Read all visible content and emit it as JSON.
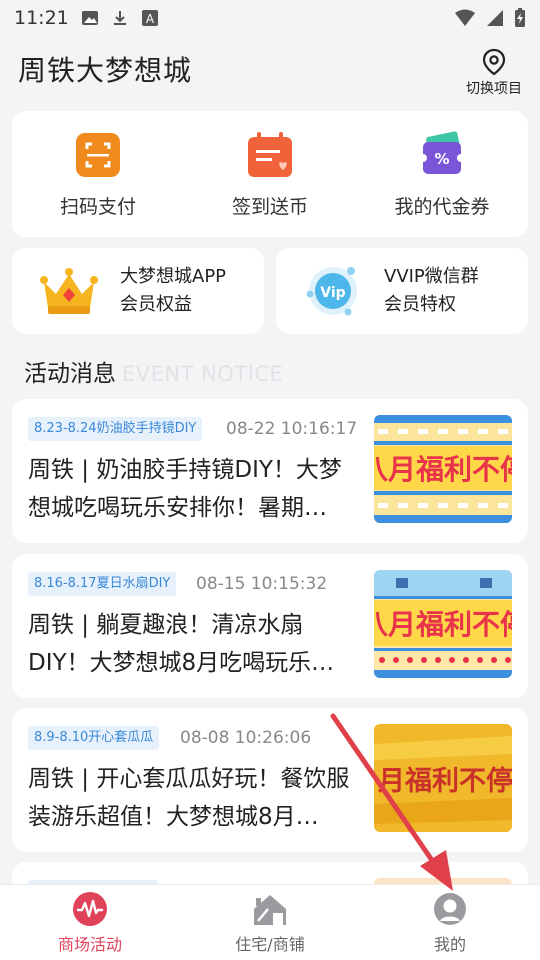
{
  "status_bar": {
    "time": "11:21"
  },
  "header": {
    "title": "周铁大梦想城",
    "switch_label": "切换项目"
  },
  "quick_actions": [
    {
      "label": "扫码支付",
      "icon": "scan-icon"
    },
    {
      "label": "签到送币",
      "icon": "calendar-icon"
    },
    {
      "label": "我的代金券",
      "icon": "voucher-icon"
    }
  ],
  "members": [
    {
      "line1": "大梦想城APP",
      "line2": "会员权益",
      "icon": "crown-icon"
    },
    {
      "line1": "VVIP微信群",
      "line2": "会员特权",
      "icon": "vip-icon"
    }
  ],
  "section": {
    "title": "活动消息",
    "subtitle": "EVENT NOTICE"
  },
  "events": [
    {
      "tag": "8.23-8.24奶油胶手持镜DIY",
      "date": "08-22 10:16:17",
      "text": "周铁 | 奶油胶手持镜DIY！大梦想城吃喝玩乐安排你！暑期…",
      "banner_text": "八月福利不停"
    },
    {
      "tag": "8.16-8.17夏日水扇DIY",
      "date": "08-15 10:15:32",
      "text": "周铁 | 躺夏趣浪！清凉水扇DIY！大梦想城8月吃喝玩乐…",
      "banner_text": "八月福利不停"
    },
    {
      "tag": "8.9-8.10开心套瓜瓜",
      "date": "08-08 10:26:06",
      "text": "周铁 | 开心套瓜瓜好玩！餐饮服装游乐超值！大梦想城8月…",
      "banner_text": "月福利不停"
    }
  ],
  "bottom_nav": [
    {
      "label": "商场活动",
      "icon": "waveform-icon",
      "active": true
    },
    {
      "label": "住宅/商铺",
      "icon": "house-icon",
      "active": false
    },
    {
      "label": "我的",
      "icon": "user-icon",
      "active": false
    }
  ],
  "colors": {
    "accent": "#e0425a",
    "tag_bg": "#e7f1fc",
    "tag_text": "#3a88d8",
    "arrow": "#e0404a"
  }
}
